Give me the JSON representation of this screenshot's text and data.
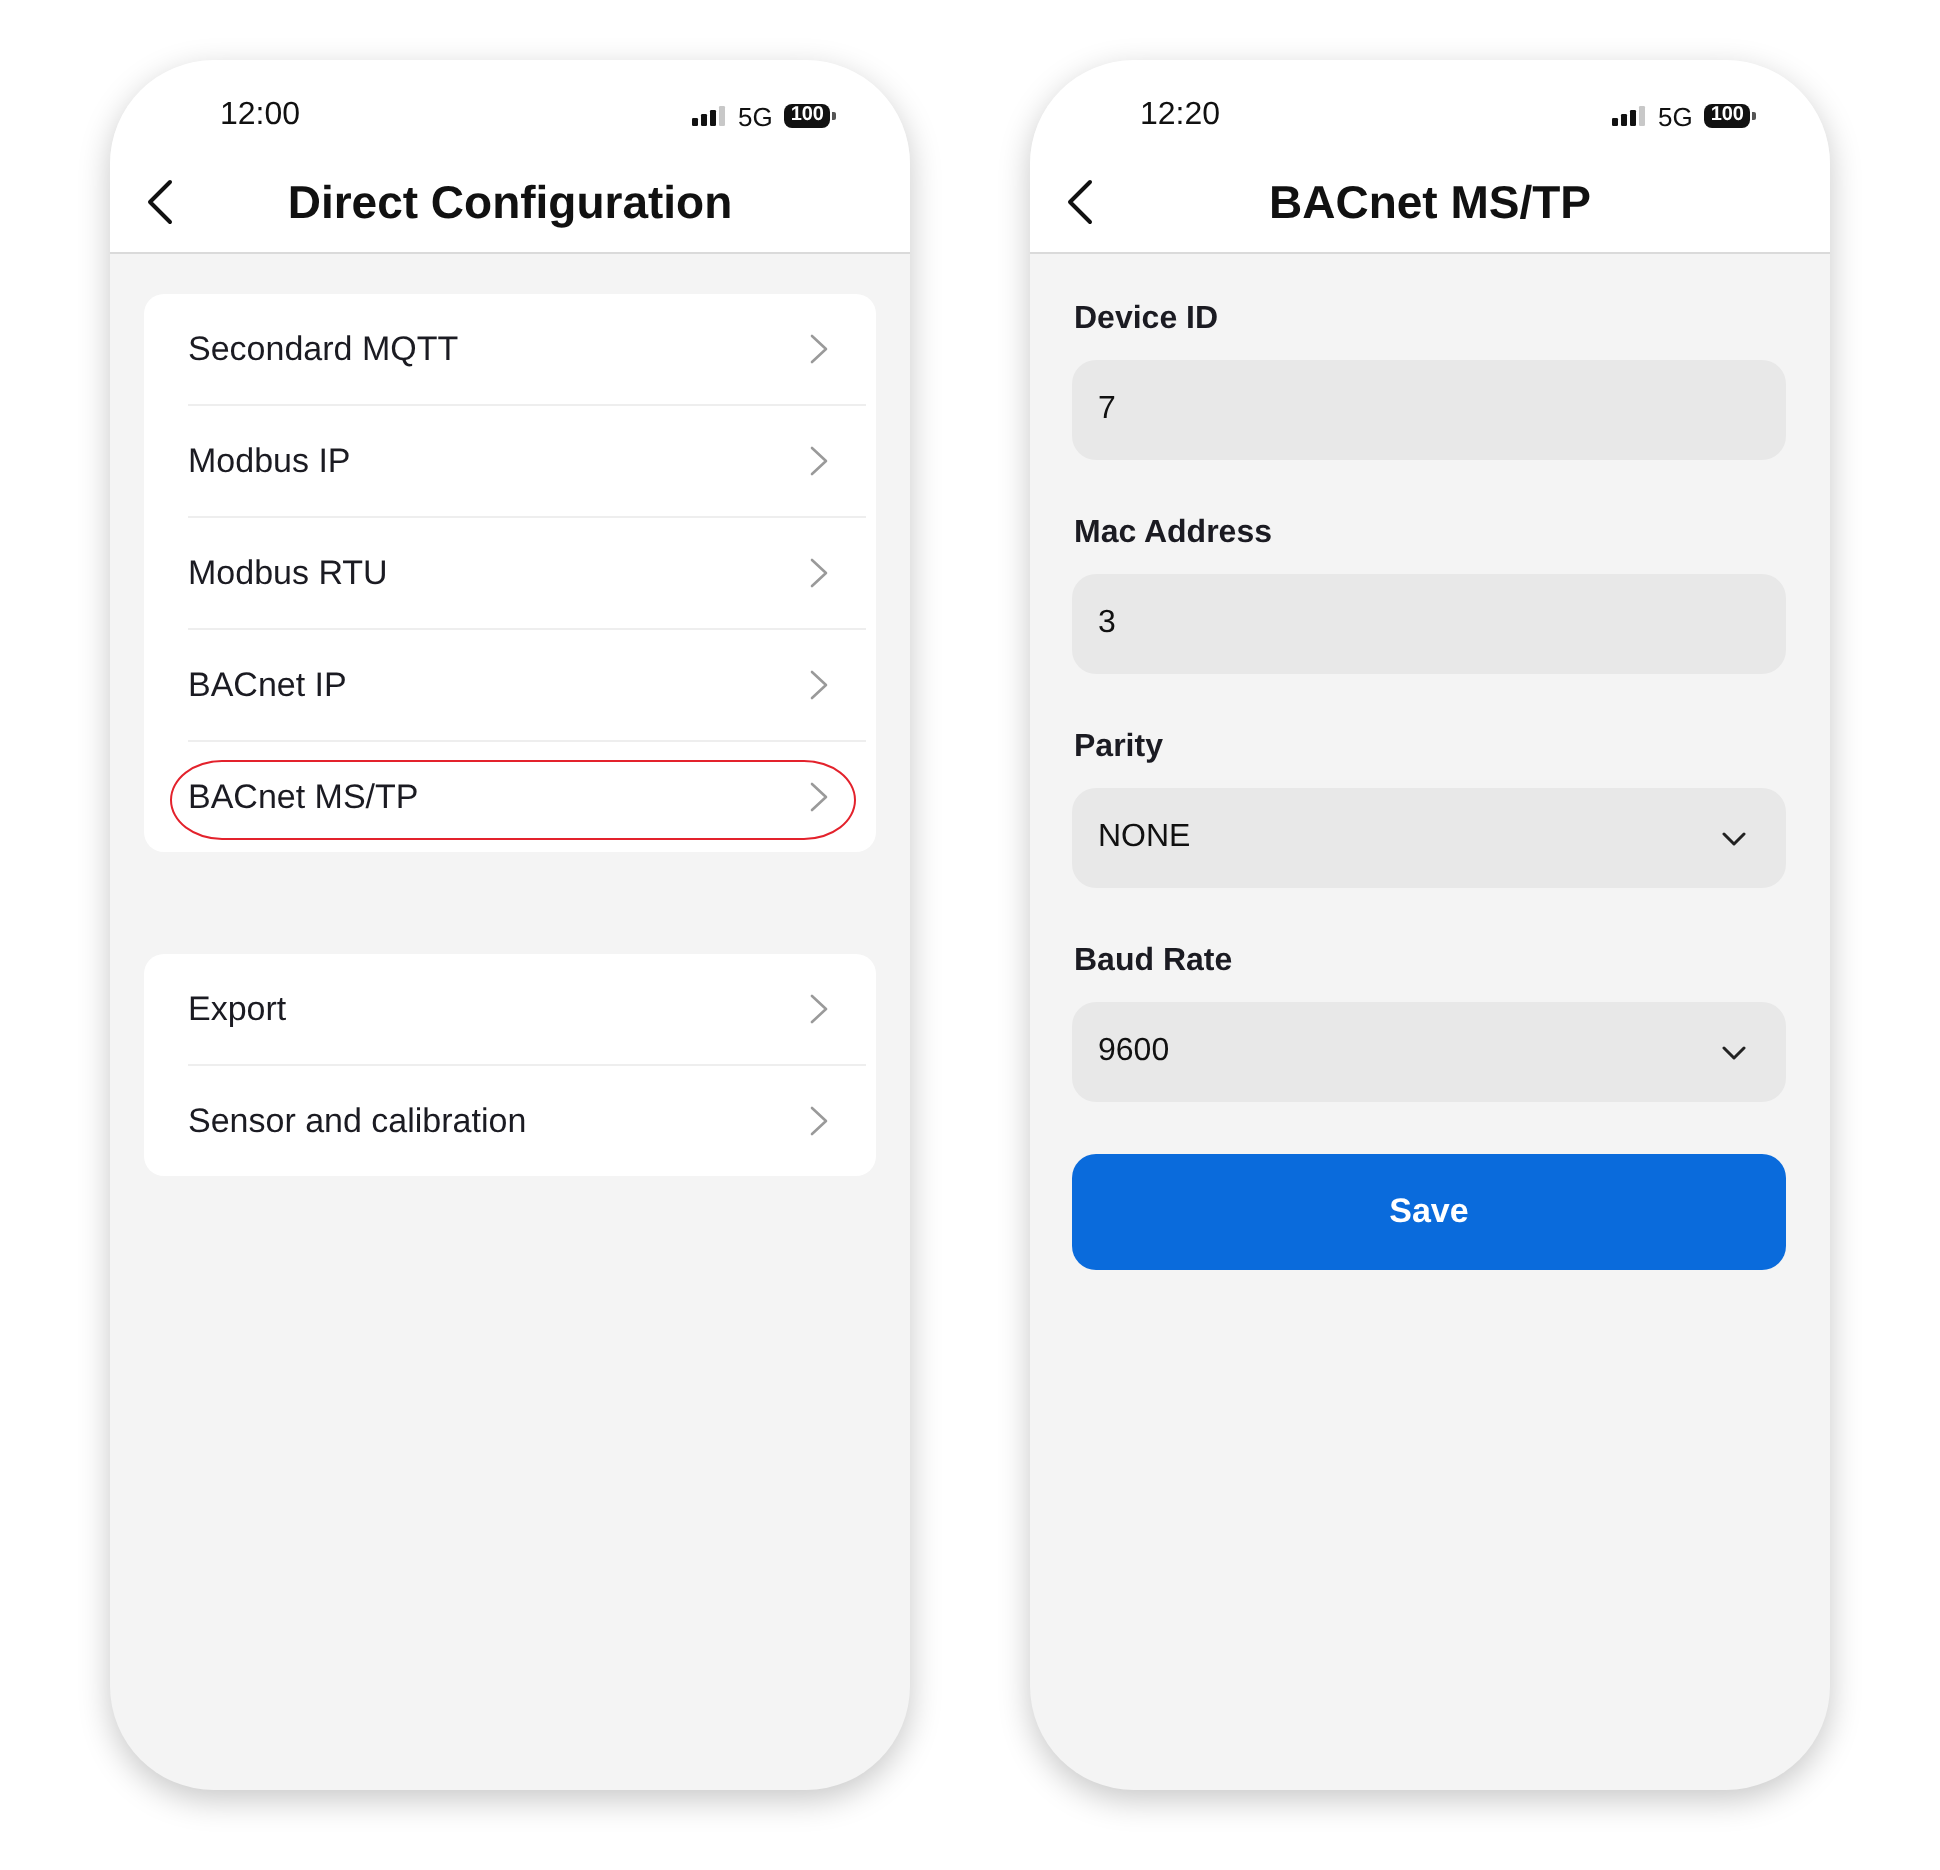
{
  "menu_screen": {
    "status_bar": {
      "time": "12:00",
      "network": "5G",
      "battery": "100"
    },
    "header": {
      "title": "Direct Configuration"
    },
    "groups": [
      {
        "items": [
          {
            "label": "Secondard MQTT",
            "highlighted": false
          },
          {
            "label": "Modbus IP",
            "highlighted": false
          },
          {
            "label": "Modbus RTU",
            "highlighted": false
          },
          {
            "label": "BACnet IP",
            "highlighted": false
          },
          {
            "label": "BACnet MS/TP",
            "highlighted": true
          }
        ]
      },
      {
        "items": [
          {
            "label": "Export",
            "highlighted": false
          },
          {
            "label": "Sensor and calibration",
            "highlighted": false
          }
        ]
      }
    ]
  },
  "form_screen": {
    "status_bar": {
      "time": "12:20",
      "network": "5G",
      "battery": "100"
    },
    "header": {
      "title": "BACnet MS/TP"
    },
    "fields": [
      {
        "label": "Device ID",
        "kind": "text",
        "value": "7"
      },
      {
        "label": "Mac Address",
        "kind": "text",
        "value": "3"
      },
      {
        "label": "Parity",
        "kind": "select",
        "value": "NONE"
      },
      {
        "label": "Baud Rate",
        "kind": "select",
        "value": "9600"
      }
    ],
    "save_button": {
      "label": "Save"
    }
  }
}
